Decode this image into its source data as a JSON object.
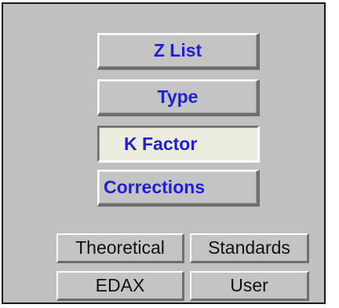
{
  "panel": {
    "buttons": {
      "z_list": "Z List",
      "type": "Type",
      "k_factor": "K Factor",
      "corrections": "Corrections"
    },
    "options": {
      "theoretical": "Theoretical",
      "standards": "Standards",
      "edax": "EDAX",
      "user": "User"
    },
    "selected": "K Factor"
  },
  "colors": {
    "panel_background": "#c0c0c0",
    "button_label_blue": "#1f1fd6",
    "button_label_black": "#111111",
    "active_button_background": "#ececdf"
  }
}
